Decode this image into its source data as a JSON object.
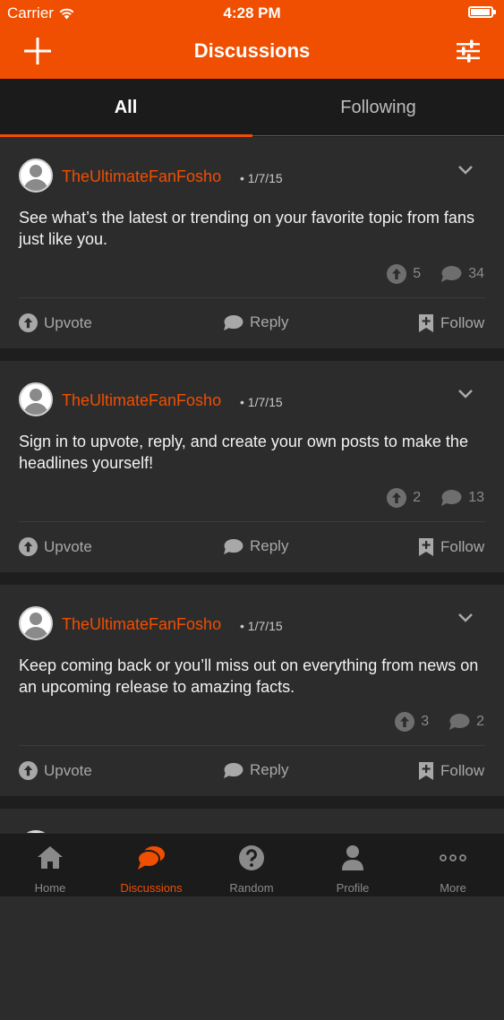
{
  "status_bar": {
    "carrier": "Carrier",
    "time": "4:28 PM"
  },
  "header": {
    "title": "Discussions"
  },
  "tabs": [
    {
      "label": "All",
      "active": true
    },
    {
      "label": "Following",
      "active": false
    }
  ],
  "posts": [
    {
      "author": "TheUltimateFanFosho",
      "date": "• 1/7/15",
      "text": "See what’s the latest or trending on your favorite topic from fans just like you.",
      "upvotes": "5",
      "comments": "34"
    },
    {
      "author": "TheUltimateFanFosho",
      "date": "• 1/7/15",
      "text": "Sign in to upvote, reply, and create your own posts to make the headlines yourself!",
      "upvotes": "2",
      "comments": "13"
    },
    {
      "author": "TheUltimateFanFosho",
      "date": "• 1/7/15",
      "text": "Keep coming back or you’ll miss out on everything from news on an upcoming release to amazing facts.",
      "upvotes": "3",
      "comments": "2"
    }
  ],
  "actions": {
    "upvote": "Upvote",
    "reply": "Reply",
    "follow": "Follow"
  },
  "tab_bar": [
    {
      "label": "Home",
      "icon": "home-icon"
    },
    {
      "label": "Discussions",
      "icon": "discussions-icon",
      "active": true
    },
    {
      "label": "Random",
      "icon": "question-icon"
    },
    {
      "label": "Profile",
      "icon": "person-icon"
    },
    {
      "label": "More",
      "icon": "more-icon"
    }
  ],
  "colors": {
    "accent": "#f04e00",
    "background": "#1e1e1e",
    "card": "#2c2c2d"
  }
}
